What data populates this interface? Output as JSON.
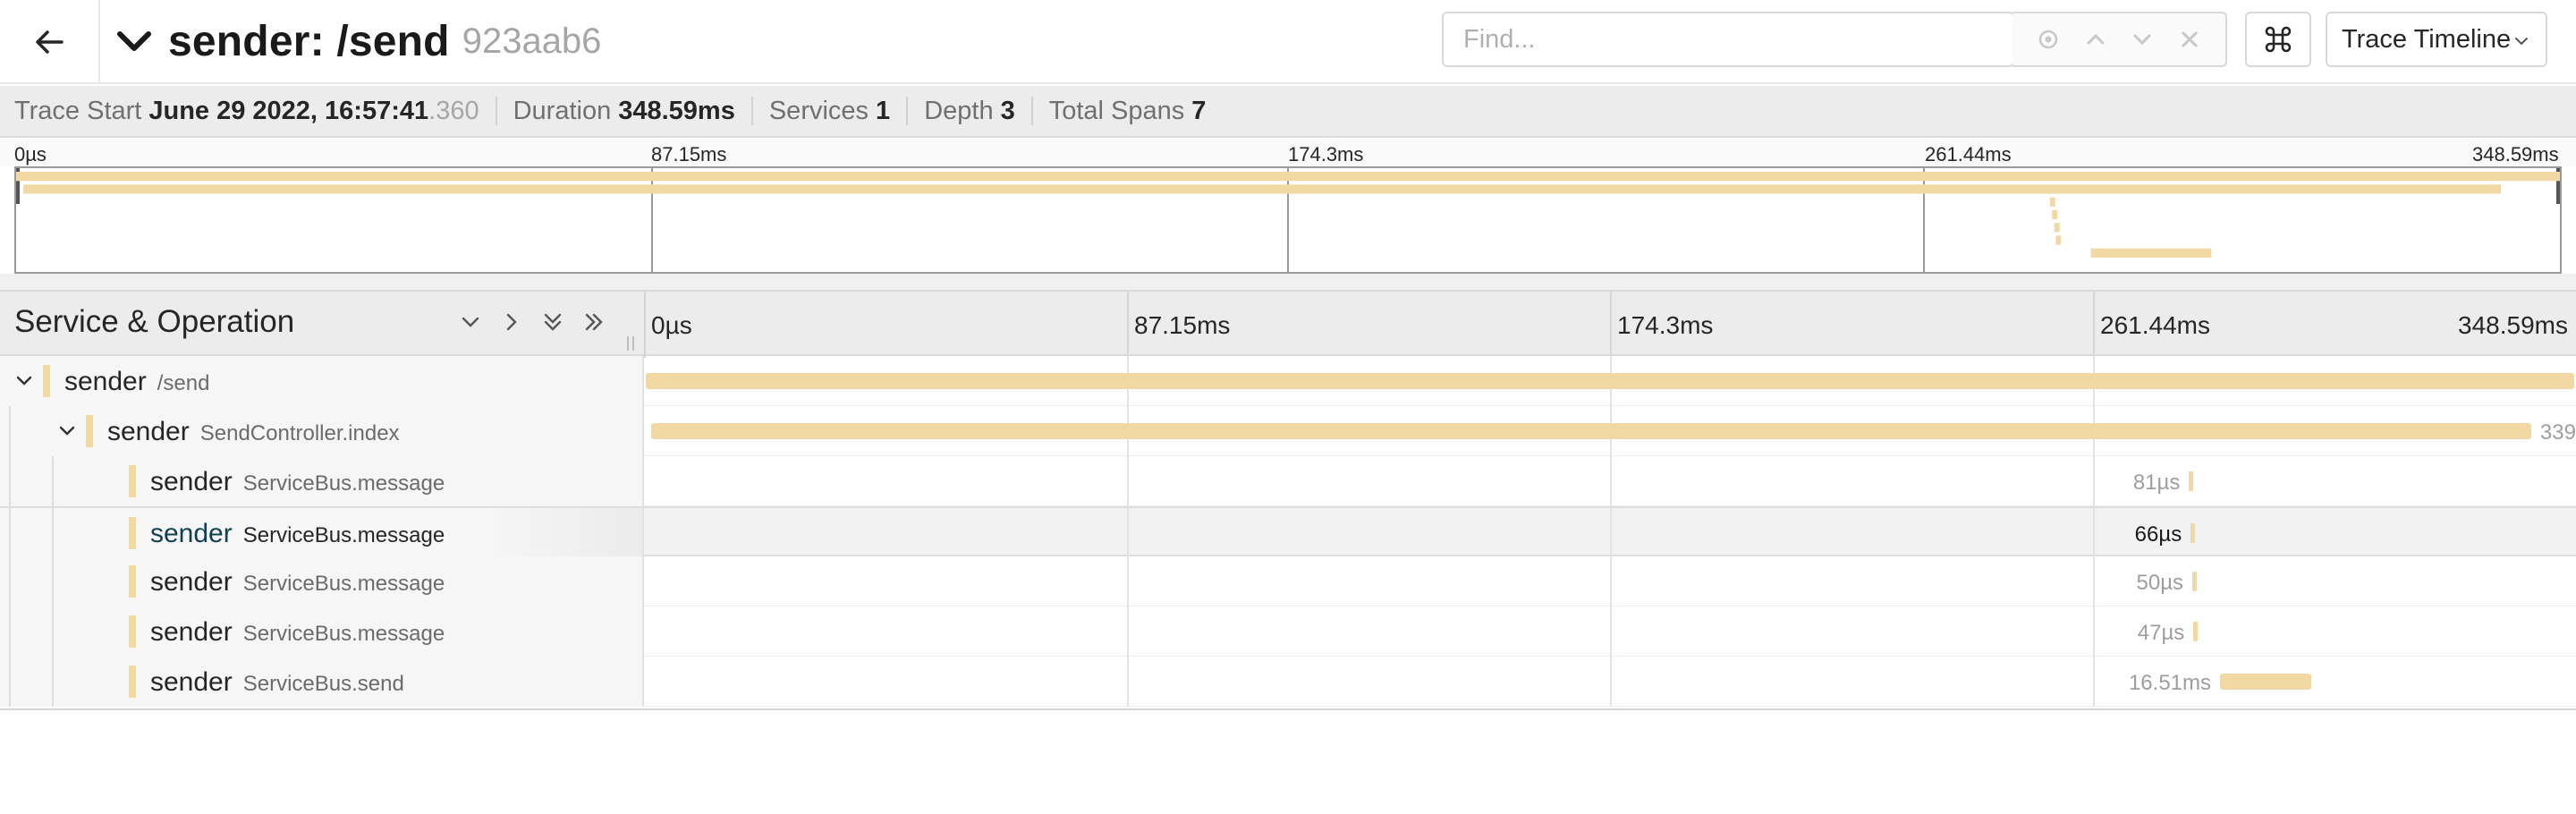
{
  "header": {
    "title": "sender: /send",
    "trace_id": "923aab6",
    "find_placeholder": "Find...",
    "view_select": "Trace Timeline"
  },
  "summary": {
    "trace_start_label": "Trace Start",
    "trace_start_value": "June 29 2022, 16:57:41",
    "trace_start_ms": ".360",
    "duration_label": "Duration",
    "duration_value": "348.59ms",
    "services_label": "Services",
    "services_value": "1",
    "depth_label": "Depth",
    "depth_value": "3",
    "total_spans_label": "Total Spans",
    "total_spans_value": "7"
  },
  "minimap": {
    "ticks": [
      "0µs",
      "87.15ms",
      "174.3ms",
      "261.44ms",
      "348.59ms"
    ]
  },
  "timeline": {
    "column_title": "Service & Operation",
    "ticks": [
      "0µs",
      "87.15ms",
      "174.3ms",
      "261.44ms",
      "348.59ms"
    ],
    "total_ms": 348.59
  },
  "spans": [
    {
      "service": "sender",
      "operation": "/send",
      "depth": 0,
      "start_ms": 0,
      "duration_ms": 348.59,
      "duration_label": ""
    },
    {
      "service": "sender",
      "operation": "SendController.index",
      "depth": 1,
      "start_ms": 1,
      "duration_ms": 339.5,
      "duration_label": "339"
    },
    {
      "service": "sender",
      "operation": "ServiceBus.message",
      "depth": 2,
      "start_ms": 278.7,
      "duration_ms": 0.081,
      "duration_label": "81µs"
    },
    {
      "service": "sender",
      "operation": "ServiceBus.message",
      "depth": 2,
      "start_ms": 279.0,
      "duration_ms": 0.066,
      "duration_label": "66µs",
      "selected": true
    },
    {
      "service": "sender",
      "operation": "ServiceBus.message",
      "depth": 2,
      "start_ms": 279.3,
      "duration_ms": 0.05,
      "duration_label": "50µs"
    },
    {
      "service": "sender",
      "operation": "ServiceBus.message",
      "depth": 2,
      "start_ms": 279.5,
      "duration_ms": 0.047,
      "duration_label": "47µs"
    },
    {
      "service": "sender",
      "operation": "ServiceBus.send",
      "depth": 2,
      "start_ms": 284.3,
      "duration_ms": 16.51,
      "duration_label": "16.51ms"
    }
  ],
  "colors": {
    "span_bar": "#f2d9a4",
    "summary_bg": "#ececec"
  },
  "icons": {
    "back": "arrow-left-icon",
    "collapse_title": "chevron-down-icon",
    "find_locate": "crosshair-icon",
    "find_prev": "chevron-up-icon",
    "find_next": "chevron-down-icon",
    "find_clear": "close-icon",
    "keyboard": "command-icon"
  }
}
